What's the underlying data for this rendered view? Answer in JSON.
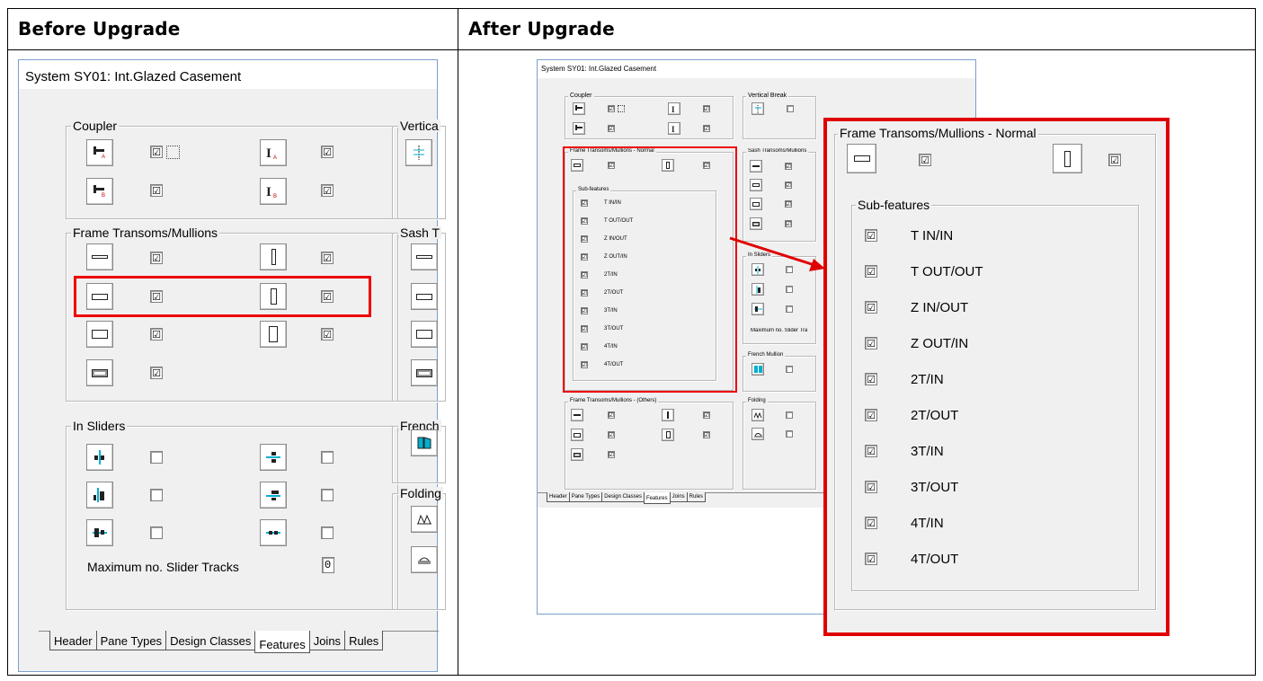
{
  "columns": {
    "before": "Before Upgrade",
    "after": "After Upgrade"
  },
  "dialog": {
    "title": "System SY01: Int.Glazed Casement",
    "groups": {
      "coupler": "Coupler",
      "vertical_break": "Vertical Break",
      "frame_transoms": "Frame Transoms/Mullions",
      "frame_transoms_normal": "Frame Transoms/Mullions - Normal",
      "frame_transoms_others": "Frame Transoms/Mullions - (Others)",
      "sash_transoms": "Sash Transoms/Mullions",
      "in_sliders": "In Sliders",
      "french_mullion": "French Mullion",
      "folding": "Folding",
      "sub_features": "Sub-features"
    },
    "clip_labels": {
      "vertical": "Vertica",
      "sash": "Sash T",
      "french": "French",
      "folding": "Folding"
    },
    "max_slider_tracks_label": "Maximum no. Slider Tracks",
    "max_slider_tracks_small": "Maximum no. Slider Tra",
    "max_slider_tracks_value": "0",
    "check": "☑",
    "tabs": [
      "Header",
      "Pane Types",
      "Design Classes",
      "Features",
      "Joins",
      "Rules"
    ],
    "active_tab": "Features",
    "sub_features": [
      "T IN/IN",
      "T OUT/OUT",
      "Z IN/OUT",
      "Z OUT/IN",
      "2T/IN",
      "2T/OUT",
      "3T/IN",
      "3T/OUT",
      "4T/IN",
      "4T/OUT"
    ]
  },
  "colors": {
    "highlight": "#e00000",
    "dialog_bg": "#f0f0f0",
    "icon_red": "#c00000",
    "icon_cyan": "#00b0d0"
  }
}
